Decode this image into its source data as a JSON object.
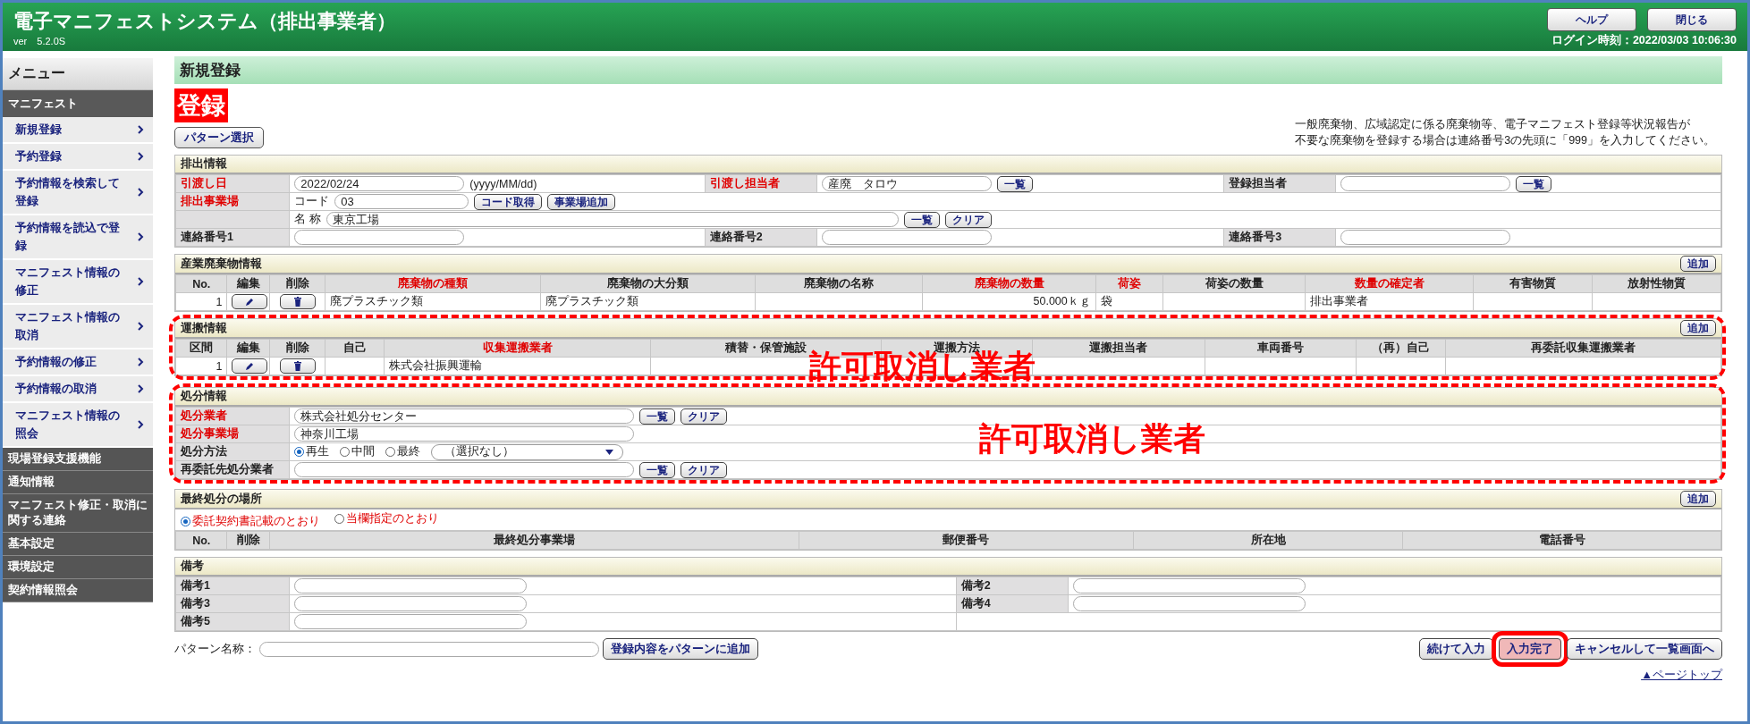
{
  "header": {
    "title": "電子マニフェストシステム（排出事業者）",
    "version": "ver　5.2.0S",
    "buttons": [
      "ヘルプ",
      "閉じる"
    ],
    "login_time": "ログイン時刻：2022/03/03 10:06:30"
  },
  "sidebar": {
    "title": "メニュー",
    "section": "マニフェスト",
    "items": [
      "新規登録",
      "予約登録",
      "予約情報を検索して登録",
      "予約情報を読込で登録",
      "マニフェスト情報の修正",
      "マニフェスト情報の取消",
      "予約情報の修正",
      "予約情報の取消",
      "マニフェスト情報の照会"
    ],
    "categories": [
      "現場登録支援機能",
      "通知情報",
      "マニフェスト修正・取消に関する連絡",
      "基本設定",
      "環境設定",
      "契約情報照会"
    ]
  },
  "page": {
    "title": "新規登録",
    "badge": "登録",
    "pattern_button": "パターン選択",
    "notice": [
      "一般廃棄物、広域認定に係る廃棄物等、電子マニフェスト登録等状況報告が",
      "不要な廃棄物を登録する場合は連絡番号3の先頭に「999」を入力してください。"
    ]
  },
  "discharge": {
    "title": "排出情報",
    "delivery_date": {
      "label": "引渡し日",
      "required": true,
      "value": "2022/02/24",
      "format": "(yyyy/MM/dd)"
    },
    "delivery_person": {
      "label": "引渡し担当者",
      "required": true,
      "value": "産廃　タロウ",
      "button": "一覧"
    },
    "registrant": {
      "label": "登録担当者",
      "required": false,
      "button": "一覧"
    },
    "site": {
      "label": "排出事業場",
      "required": true,
      "code_label": "コード",
      "code": "03",
      "code_buttons": [
        "コード取得",
        "事業場追加"
      ],
      "name_label": "名 称",
      "name": "東京工場",
      "name_buttons": [
        "一覧",
        "クリア"
      ]
    },
    "contacts": [
      {
        "label": "連絡番号1"
      },
      {
        "label": "連絡番号2"
      },
      {
        "label": "連絡番号3"
      }
    ]
  },
  "waste": {
    "title": "産業廃棄物情報",
    "add_button": "追加",
    "columns": [
      {
        "label": "No.",
        "required": false,
        "kind": "number",
        "cells": [
          "1"
        ]
      },
      {
        "label": "編集",
        "required": false,
        "kind": "edit"
      },
      {
        "label": "削除",
        "required": false,
        "kind": "delete"
      },
      {
        "label": "廃棄物の種類",
        "required": true,
        "kind": "text",
        "cells": [
          "廃プラスチック類"
        ]
      },
      {
        "label": "廃棄物の大分類",
        "required": false,
        "kind": "text",
        "cells": [
          "廃プラスチック類"
        ]
      },
      {
        "label": "廃棄物の名称",
        "required": false,
        "kind": "text"
      },
      {
        "label": "廃棄物の数量",
        "required": true,
        "kind": "number",
        "cells": [
          "50.000ｋｇ"
        ]
      },
      {
        "label": "荷姿",
        "required": true,
        "kind": "text",
        "cells": [
          "袋"
        ]
      },
      {
        "label": "荷姿の数量",
        "required": false,
        "kind": "text"
      },
      {
        "label": "数量の確定者",
        "required": true,
        "kind": "text",
        "cells": [
          "排出事業者"
        ]
      },
      {
        "label": "有害物質",
        "required": false,
        "kind": "text"
      },
      {
        "label": "放射性物質",
        "required": false,
        "kind": "text"
      }
    ]
  },
  "transport": {
    "title": "運搬情報",
    "add_button": "追加",
    "annotation": "許可取消し業者",
    "columns": [
      {
        "label": "区間",
        "required": false,
        "kind": "number",
        "cells": [
          "1"
        ]
      },
      {
        "label": "編集",
        "required": false,
        "kind": "edit"
      },
      {
        "label": "削除",
        "required": false,
        "kind": "delete"
      },
      {
        "label": "自己",
        "required": false,
        "kind": "text"
      },
      {
        "label": "収集運搬業者",
        "required": true,
        "kind": "text",
        "cells": [
          "株式会社振興運輸"
        ]
      },
      {
        "label": "積替・保管施設",
        "required": false,
        "kind": "text"
      },
      {
        "label": "運搬方法",
        "required": false,
        "kind": "text"
      },
      {
        "label": "運搬担当者",
        "required": false,
        "kind": "text"
      },
      {
        "label": "車両番号",
        "required": false,
        "kind": "text"
      },
      {
        "label": "（再）自己",
        "required": false,
        "kind": "text"
      },
      {
        "label": "再委託収集運搬業者",
        "required": false,
        "kind": "text"
      }
    ]
  },
  "disposal": {
    "title": "処分情報",
    "annotation": "許可取消し業者",
    "disposer": {
      "label": "処分業者",
      "required": true,
      "value": "株式会社処分センター",
      "buttons": [
        "一覧",
        "クリア"
      ]
    },
    "site": {
      "label": "処分事業場",
      "required": true,
      "value": "神奈川工場"
    },
    "method": {
      "label": "処分方法",
      "required": false,
      "options": [
        {
          "label": "再生",
          "selected": true
        },
        {
          "label": "中間",
          "selected": false
        },
        {
          "label": "最終",
          "selected": false
        }
      ],
      "select": "（選択なし）"
    },
    "subcontract": {
      "label": "再委託先処分業者",
      "required": false,
      "buttons": [
        "一覧",
        "クリア"
      ]
    }
  },
  "final": {
    "title": "最終処分の場所",
    "add_button": "追加",
    "options": [
      {
        "label": "委託契約書記載のとおり",
        "selected": true
      },
      {
        "label": "当欄指定のとおり",
        "selected": false
      }
    ],
    "columns": [
      "No.",
      "削除",
      "最終処分事業場",
      "郵便番号",
      "所在地",
      "電話番号"
    ]
  },
  "remarks": {
    "title": "備考",
    "fields": [
      {
        "label": "備考1"
      },
      {
        "label": "備考2"
      },
      {
        "label": "備考3"
      },
      {
        "label": "備考4"
      },
      {
        "label": "備考5"
      }
    ]
  },
  "footer": {
    "pattern_label": "パターン名称：",
    "pattern_button": "登録内容をパターンに追加",
    "buttons": [
      {
        "label": "続けて入力",
        "highlighted": false
      },
      {
        "label": "入力完了",
        "highlighted": true
      },
      {
        "label": "キャンセルして一覧画面へ",
        "highlighted": false
      }
    ],
    "page_top": "▲ページトップ"
  }
}
